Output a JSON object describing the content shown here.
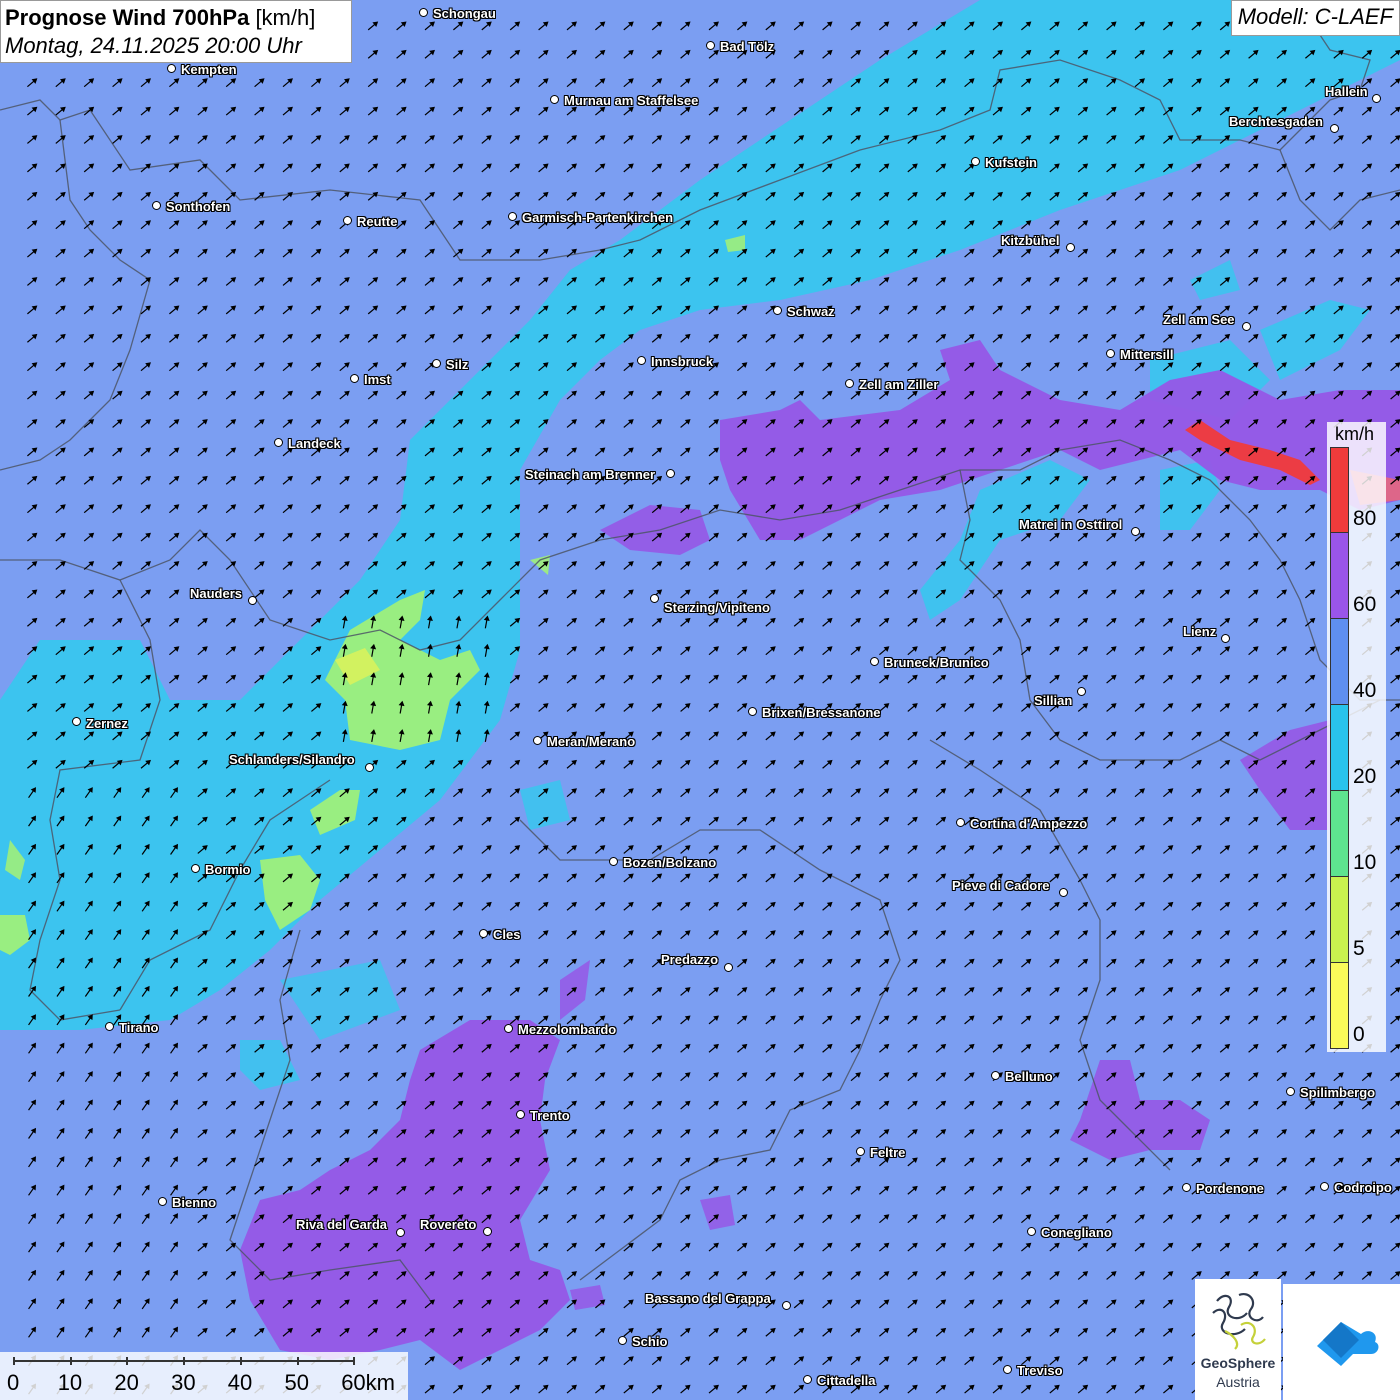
{
  "header": {
    "title_bold": "Prognose Wind 700hPa",
    "title_unit": "[km/h]",
    "date_line": "Montag, 24.11.2025 20:00 Uhr",
    "model": "Modell: C-LAEF"
  },
  "legend": {
    "unit": "km/h",
    "labels": [
      "80",
      "60",
      "40",
      "20",
      "10",
      "5",
      "0"
    ],
    "colors": [
      "#f03b3b",
      "#9a55e9",
      "#5f8ff0",
      "#29c3ec",
      "#5ee48f",
      "#c9f24f",
      "#fafa5a"
    ]
  },
  "scale_bar": {
    "labels": [
      "0",
      "10",
      "20",
      "30",
      "40",
      "50",
      "60km"
    ]
  },
  "cities": [
    {
      "name": "Schongau",
      "dot": [
        424,
        13
      ],
      "label": [
        433,
        6
      ]
    },
    {
      "name": "Bad Tölz",
      "dot": [
        711,
        46
      ],
      "label": [
        720,
        39
      ]
    },
    {
      "name": "Kempten",
      "dot": [
        172,
        69
      ],
      "label": [
        181,
        62
      ]
    },
    {
      "name": "Murnau am Staffelsee",
      "dot": [
        555,
        100
      ],
      "label": [
        564,
        93
      ]
    },
    {
      "name": "Hallein",
      "dot": [
        1377,
        99
      ],
      "label": [
        1325,
        84
      ]
    },
    {
      "name": "Berchtesgaden",
      "dot": [
        1335,
        129
      ],
      "label": [
        1229,
        114
      ]
    },
    {
      "name": "Kufstein",
      "dot": [
        976,
        162
      ],
      "label": [
        985,
        155
      ]
    },
    {
      "name": "Sonthofen",
      "dot": [
        157,
        206
      ],
      "label": [
        166,
        199
      ]
    },
    {
      "name": "Reutte",
      "dot": [
        348,
        221
      ],
      "label": [
        357,
        214
      ]
    },
    {
      "name": "Garmisch-Partenkirchen",
      "dot": [
        513,
        217
      ],
      "label": [
        522,
        210
      ]
    },
    {
      "name": "Kitzbühel",
      "dot": [
        1071,
        248
      ],
      "label": [
        1001,
        233
      ]
    },
    {
      "name": "Schwaz",
      "dot": [
        778,
        311
      ],
      "label": [
        787,
        304
      ]
    },
    {
      "name": "Zell am See",
      "dot": [
        1247,
        327
      ],
      "label": [
        1163,
        312
      ]
    },
    {
      "name": "Mittersill",
      "dot": [
        1111,
        354
      ],
      "label": [
        1120,
        347
      ]
    },
    {
      "name": "Innsbruck",
      "dot": [
        642,
        361
      ],
      "label": [
        651,
        354
      ]
    },
    {
      "name": "Silz",
      "dot": [
        437,
        364
      ],
      "label": [
        446,
        357
      ]
    },
    {
      "name": "Imst",
      "dot": [
        355,
        379
      ],
      "label": [
        364,
        372
      ]
    },
    {
      "name": "Zell am Ziller",
      "dot": [
        850,
        384
      ],
      "label": [
        859,
        377
      ]
    },
    {
      "name": "Landeck",
      "dot": [
        279,
        443
      ],
      "label": [
        288,
        436
      ]
    },
    {
      "name": "Steinach am Brenner",
      "dot": [
        671,
        474
      ],
      "label": [
        525,
        467
      ]
    },
    {
      "name": "Matrei in Osttirol",
      "dot": [
        1136,
        532
      ],
      "label": [
        1019,
        517
      ]
    },
    {
      "name": "Nauders",
      "dot": [
        253,
        601
      ],
      "label": [
        190,
        586
      ]
    },
    {
      "name": "Sterzing/Vipiteno",
      "dot": [
        655,
        599
      ],
      "label": [
        664,
        600
      ]
    },
    {
      "name": "Lienz",
      "dot": [
        1226,
        639
      ],
      "label": [
        1183,
        624
      ]
    },
    {
      "name": "Bruneck/Brunico",
      "dot": [
        875,
        662
      ],
      "label": [
        884,
        655
      ]
    },
    {
      "name": "Sillian",
      "dot": [
        1082,
        692
      ],
      "label": [
        1034,
        693
      ]
    },
    {
      "name": "Brixen/Bressanone",
      "dot": [
        753,
        712
      ],
      "label": [
        762,
        705
      ]
    },
    {
      "name": "Zernez",
      "dot": [
        77,
        722
      ],
      "label": [
        86,
        716
      ]
    },
    {
      "name": "Meran/Merano",
      "dot": [
        538,
        741
      ],
      "label": [
        547,
        734
      ]
    },
    {
      "name": "Schlanders/Silandro",
      "dot": [
        370,
        768
      ],
      "label": [
        229,
        752
      ]
    },
    {
      "name": "Cortina d'Ampezzo",
      "dot": [
        961,
        823
      ],
      "label": [
        970,
        816
      ]
    },
    {
      "name": "Bozen/Bolzano",
      "dot": [
        614,
        862
      ],
      "label": [
        623,
        855
      ]
    },
    {
      "name": "Bormio",
      "dot": [
        196,
        869
      ],
      "label": [
        205,
        862
      ]
    },
    {
      "name": "Pieve di Cadore",
      "dot": [
        1064,
        893
      ],
      "label": [
        952,
        878
      ]
    },
    {
      "name": "Cles",
      "dot": [
        484,
        934
      ],
      "label": [
        493,
        927
      ]
    },
    {
      "name": "Predazzo",
      "dot": [
        729,
        968
      ],
      "label": [
        661,
        952
      ]
    },
    {
      "name": "Tirano",
      "dot": [
        110,
        1027
      ],
      "label": [
        119,
        1020
      ]
    },
    {
      "name": "Mezzolombardo",
      "dot": [
        509,
        1029
      ],
      "label": [
        518,
        1022
      ]
    },
    {
      "name": "Belluno",
      "dot": [
        996,
        1076
      ],
      "label": [
        1005,
        1069
      ]
    },
    {
      "name": "Spilimbergo",
      "dot": [
        1291,
        1092
      ],
      "label": [
        1300,
        1085
      ]
    },
    {
      "name": "Trento",
      "dot": [
        521,
        1115
      ],
      "label": [
        530,
        1108
      ]
    },
    {
      "name": "Feltre",
      "dot": [
        861,
        1152
      ],
      "label": [
        870,
        1145
      ]
    },
    {
      "name": "Pordenone",
      "dot": [
        1187,
        1188
      ],
      "label": [
        1196,
        1181
      ]
    },
    {
      "name": "Codroipo",
      "dot": [
        1325,
        1187
      ],
      "label": [
        1334,
        1180
      ]
    },
    {
      "name": "Bienno",
      "dot": [
        163,
        1202
      ],
      "label": [
        172,
        1195
      ]
    },
    {
      "name": "Riva del Garda",
      "dot": [
        401,
        1233
      ],
      "label": [
        296,
        1217
      ]
    },
    {
      "name": "Rovereto",
      "dot": [
        488,
        1232
      ],
      "label": [
        420,
        1217
      ]
    },
    {
      "name": "Conegliano",
      "dot": [
        1032,
        1232
      ],
      "label": [
        1041,
        1225
      ]
    },
    {
      "name": "Bassano del Grappa",
      "dot": [
        787,
        1306
      ],
      "label": [
        645,
        1291
      ]
    },
    {
      "name": "Schio",
      "dot": [
        623,
        1341
      ],
      "label": [
        632,
        1334
      ]
    },
    {
      "name": "Treviso",
      "dot": [
        1008,
        1370
      ],
      "label": [
        1017,
        1363
      ]
    },
    {
      "name": "Cittadella",
      "dot": [
        808,
        1380
      ],
      "label": [
        817,
        1373
      ]
    }
  ],
  "logos": {
    "geosphere_line1": "GeoSphere",
    "geosphere_line2": "Austria"
  }
}
